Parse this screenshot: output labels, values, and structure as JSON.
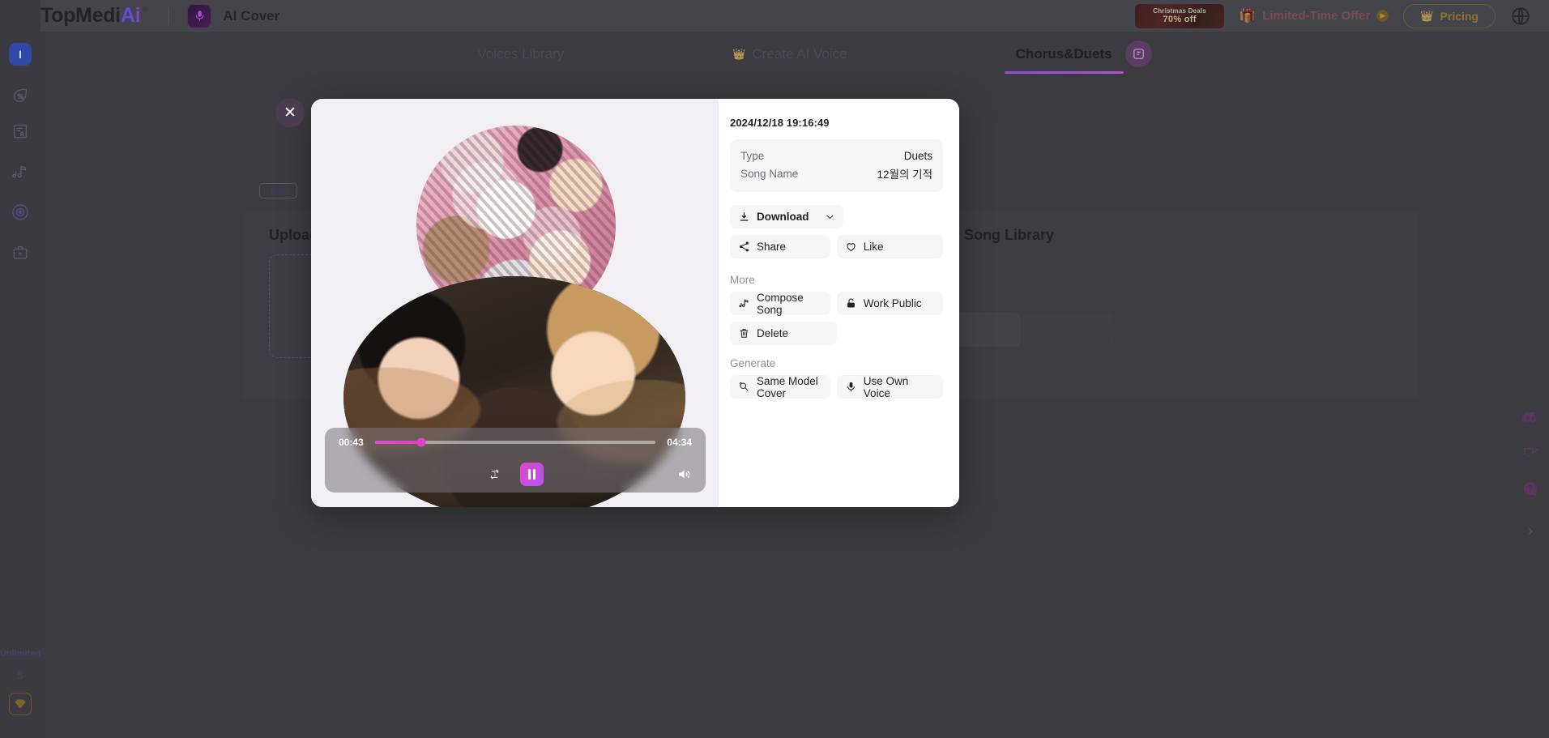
{
  "header": {
    "logo_text": "TopMedi",
    "logo_accent_a": "A",
    "logo_accent_i": "i",
    "logo_reg": "®",
    "app_title": "AI Cover",
    "app_icon": "microphone-icon",
    "promo_banner": {
      "line1": "Christmas Deals",
      "line2": "70% off"
    },
    "limited_offer": {
      "label": "Limited-Time Offer",
      "icon": "gift-icon",
      "arrow": "▶"
    },
    "pricing": {
      "label": "Pricing",
      "icon": "crown-icon"
    },
    "language_icon": "globe-icon"
  },
  "nav": {
    "tabs": [
      {
        "label": "Voices Library",
        "active": false,
        "icon": ""
      },
      {
        "label": "Create AI Voice",
        "active": false,
        "icon": "crown-icon"
      },
      {
        "label": "Chorus&Duets",
        "active": true,
        "icon": ""
      }
    ],
    "right_icon": "library-icon"
  },
  "sidebar": {
    "badge": "I",
    "items": [
      {
        "name": "discount-icon"
      },
      {
        "name": "document-icon"
      },
      {
        "name": "music-note-icon"
      },
      {
        "name": "disc-icon",
        "active": true
      },
      {
        "name": "toolbox-icon"
      }
    ],
    "footer": {
      "plan": "Unlimited",
      "credits": "5",
      "gem_icon": "gem-icon"
    }
  },
  "page": {
    "back_label": "Back",
    "back_chevron": "‹",
    "upload_title": "Upload",
    "song_library_title": "Song Library"
  },
  "rail": {
    "icons": [
      "discord-icon",
      "feedback-icon",
      "help-icon"
    ],
    "collapse": "›"
  },
  "modal": {
    "close_icon": "close-icon",
    "date": "2024/12/18 19:16:49",
    "info": [
      {
        "key": "Type",
        "value": "Duets"
      },
      {
        "key": "Song Name",
        "value": "12월의 기적"
      }
    ],
    "download": {
      "label": "Download",
      "icon": "download-icon",
      "chevron": "⌄"
    },
    "share": {
      "label": "Share",
      "icon": "share-icon"
    },
    "like": {
      "label": "Like",
      "icon": "heart-icon"
    },
    "more_section": "More",
    "more_actions": [
      {
        "label": "Compose Song",
        "icon": "music-note-icon"
      },
      {
        "label": "Work Public",
        "icon": "lock-icon"
      },
      {
        "label": "Delete",
        "icon": "trash-icon"
      }
    ],
    "generate_section": "Generate",
    "generate_actions": [
      {
        "label": "Same Model Cover",
        "icon": "model-cover-icon"
      },
      {
        "label": "Use Own Voice",
        "icon": "microphone-icon"
      }
    ],
    "player": {
      "current_time": "00:43",
      "total_time": "04:34",
      "progress_percent": 16.5,
      "loop_icon": "repeat-one-icon",
      "play_state_icon": "pause-icon",
      "volume_icon": "volume-icon"
    }
  },
  "colors": {
    "accent_pink": "#e040c6",
    "accent_purple": "#b455f0",
    "tab_underline": "#8b4fd8",
    "sidebar_badge": "#2f49a8"
  }
}
